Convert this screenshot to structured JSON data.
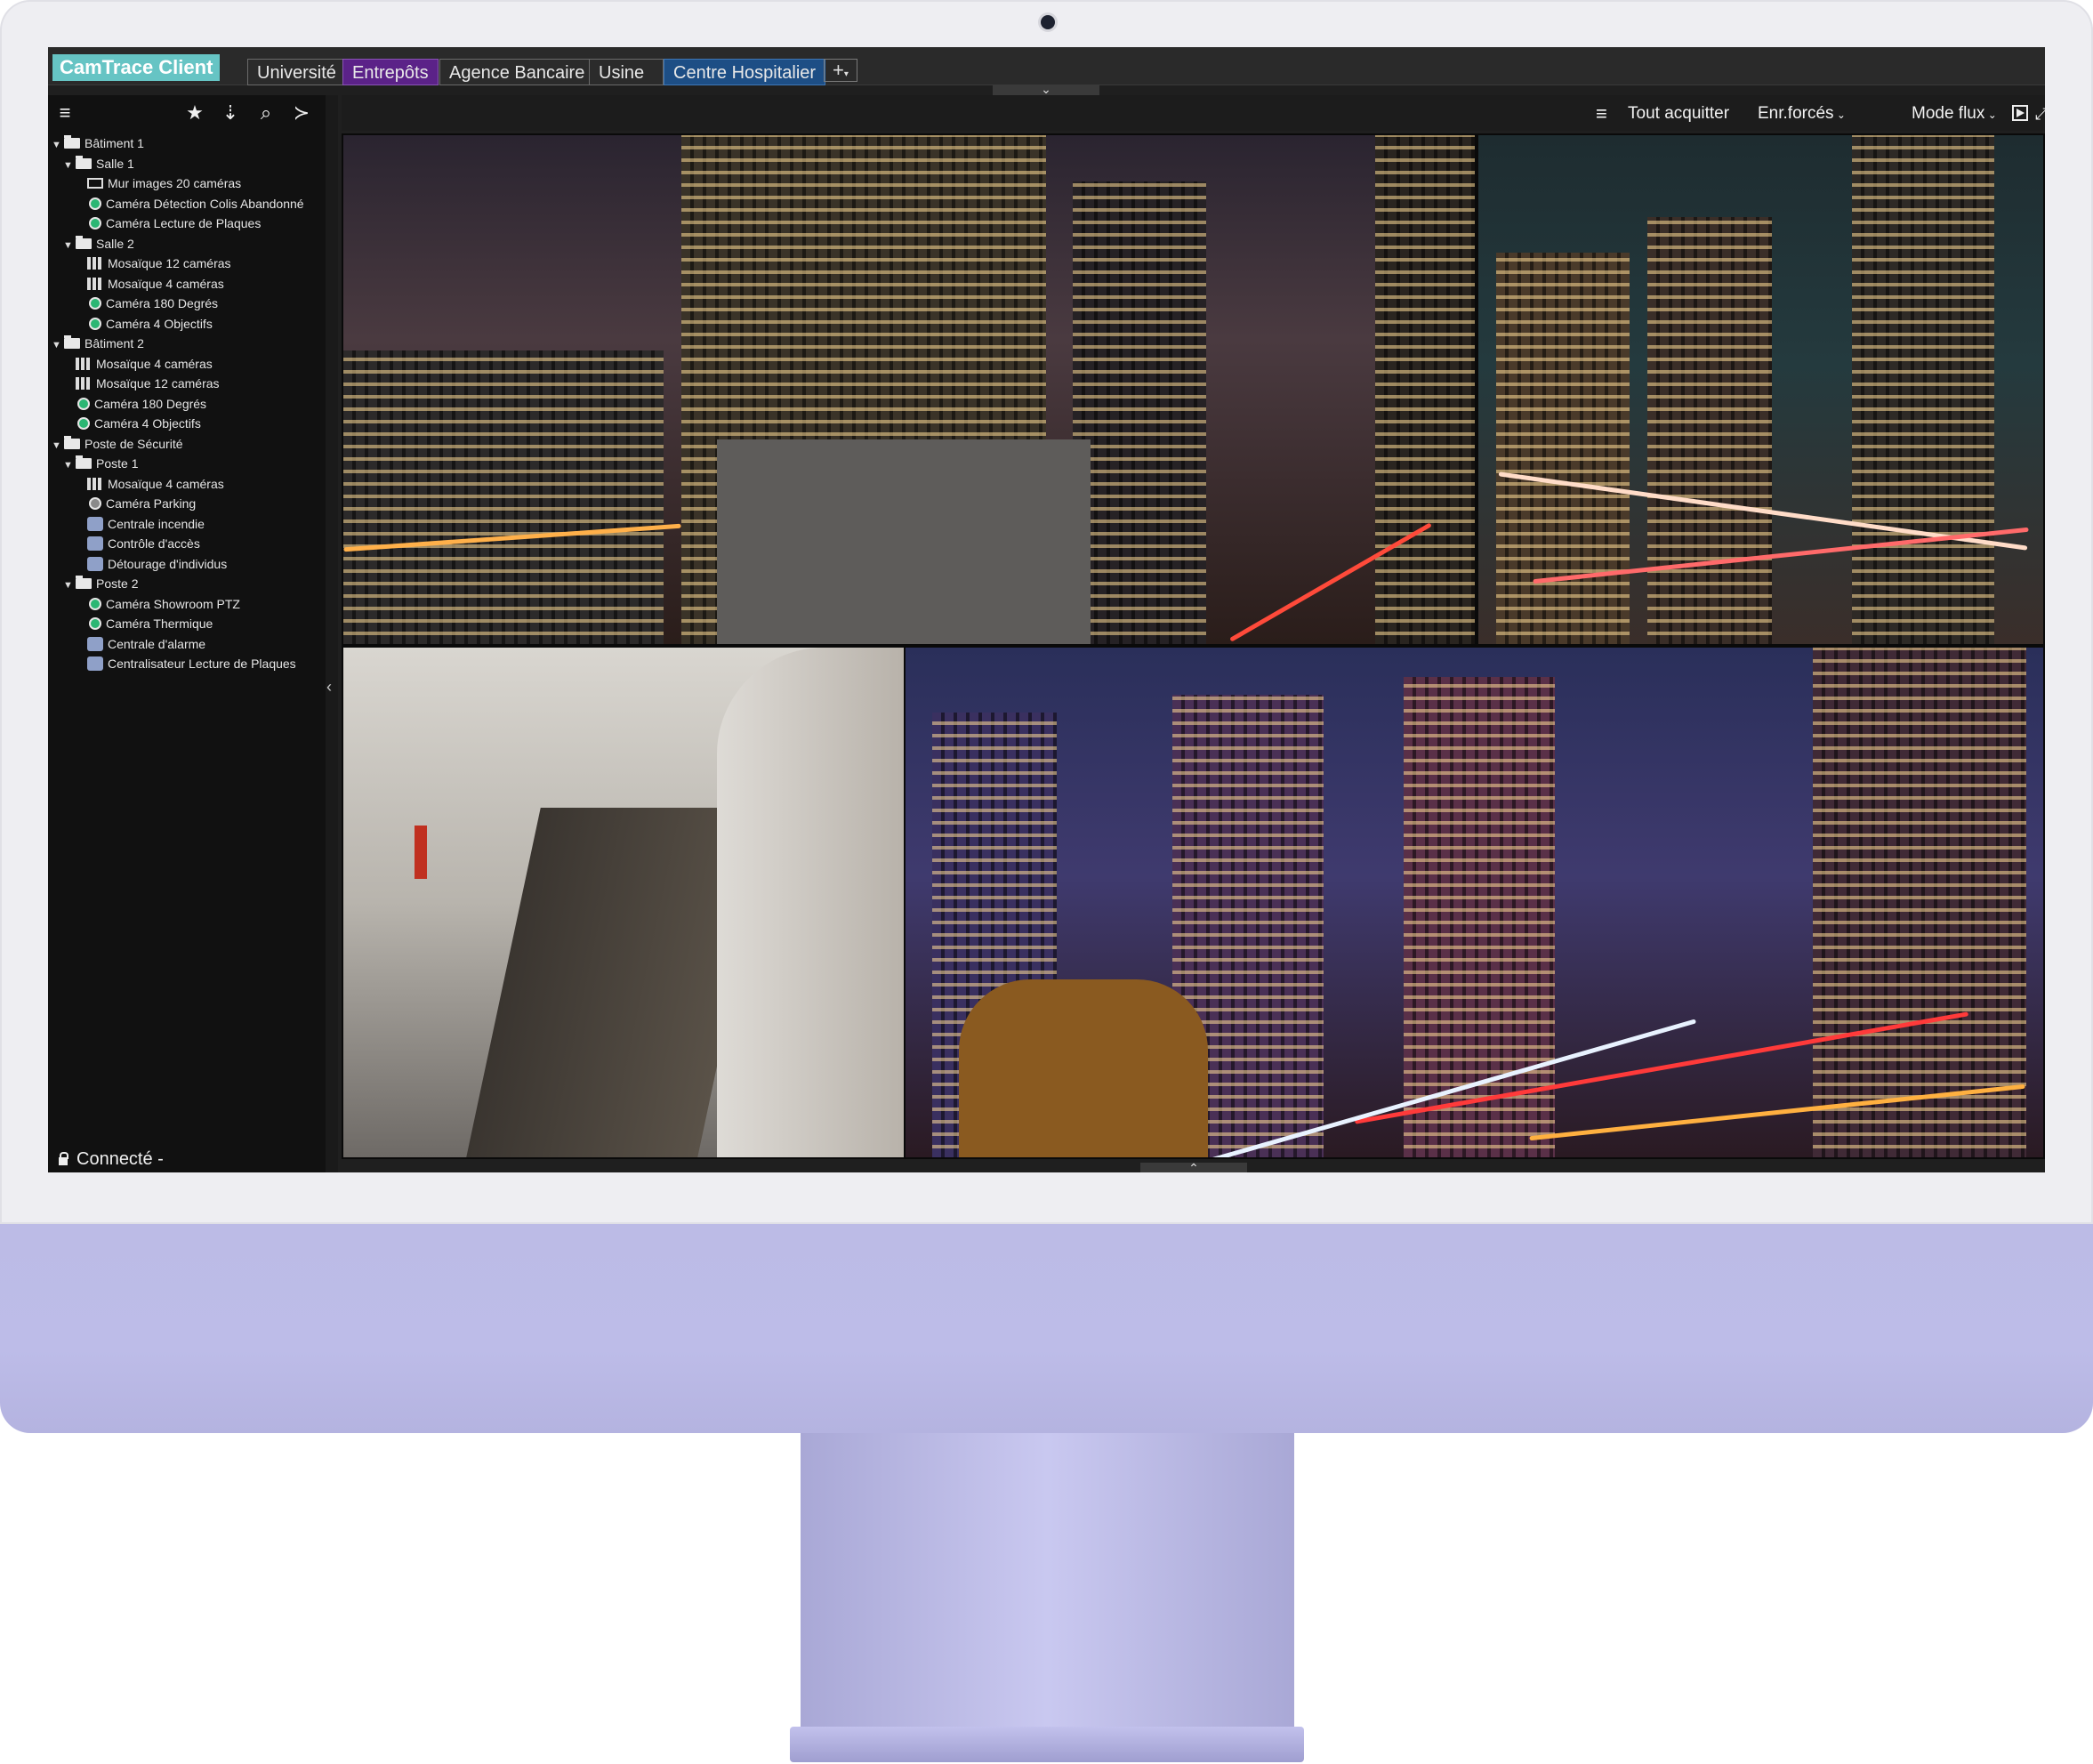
{
  "app": {
    "title": "CamTrace Client"
  },
  "tabs": [
    {
      "label": "Université",
      "style": "default"
    },
    {
      "label": "Entrepôts",
      "style": "purple"
    },
    {
      "label": "Agence Bancaire",
      "style": "default"
    },
    {
      "label": "Usine",
      "style": "default"
    },
    {
      "label": "Centre Hospitalier",
      "style": "blue"
    }
  ],
  "tab_add": {
    "label": "+"
  },
  "sidebar": {
    "tools": [
      "menu-icon",
      "star-icon",
      "sort-icon",
      "search-icon",
      "terminal-icon"
    ],
    "tree": [
      {
        "label": "Bâtiment 1",
        "level": 0,
        "icon": "folder",
        "expanded": true
      },
      {
        "label": "Salle 1",
        "level": 1,
        "icon": "folder",
        "expanded": true
      },
      {
        "label": "Mur images 20 caméras",
        "level": 2,
        "icon": "monitor"
      },
      {
        "label": "Caméra Détection Colis Abandonné",
        "level": 2,
        "icon": "cam"
      },
      {
        "label": "Caméra Lecture de Plaques",
        "level": 2,
        "icon": "cam"
      },
      {
        "label": "Salle 2",
        "level": 1,
        "icon": "folder",
        "expanded": true
      },
      {
        "label": "Mosaïque 12 caméras",
        "level": 2,
        "icon": "grid"
      },
      {
        "label": "Mosaïque 4 caméras",
        "level": 2,
        "icon": "grid"
      },
      {
        "label": "Caméra 180 Degrés",
        "level": 2,
        "icon": "cam"
      },
      {
        "label": "Caméra 4 Objectifs",
        "level": 2,
        "icon": "cam"
      },
      {
        "label": "Bâtiment 2",
        "level": 0,
        "icon": "folder",
        "expanded": true
      },
      {
        "label": "Mosaïque 4 caméras",
        "level": 1,
        "icon": "grid"
      },
      {
        "label": "Mosaïque 12 caméras",
        "level": 1,
        "icon": "grid"
      },
      {
        "label": "Caméra 180 Degrés",
        "level": 1,
        "icon": "cam"
      },
      {
        "label": "Caméra 4 Objectifs",
        "level": 1,
        "icon": "cam"
      },
      {
        "label": "Poste de Sécurité",
        "level": 0,
        "icon": "folder",
        "expanded": true
      },
      {
        "label": "Poste 1",
        "level": 1,
        "icon": "folder",
        "expanded": true
      },
      {
        "label": "Mosaïque 4 caméras",
        "level": 2,
        "icon": "grid"
      },
      {
        "label": "Caméra Parking",
        "level": 2,
        "icon": "camgray"
      },
      {
        "label": "Centrale incendie",
        "level": 2,
        "icon": "alarm"
      },
      {
        "label": "Contrôle d'accès",
        "level": 2,
        "icon": "alarm"
      },
      {
        "label": "Détourage d'individus",
        "level": 2,
        "icon": "alarm"
      },
      {
        "label": "Poste 2",
        "level": 1,
        "icon": "folder",
        "expanded": true
      },
      {
        "label": "Caméra Showroom PTZ",
        "level": 2,
        "icon": "cam"
      },
      {
        "label": "Caméra Thermique",
        "level": 2,
        "icon": "cam"
      },
      {
        "label": "Centrale d'alarme",
        "level": 2,
        "icon": "alarm"
      },
      {
        "label": "Centralisateur Lecture de Plaques",
        "level": 2,
        "icon": "alarm"
      }
    ],
    "footer": {
      "status": "Connecté -"
    }
  },
  "toolbar": {
    "menu": "menu-icon",
    "ack_all": "Tout acquitter",
    "forced_rec": "Enr.forcés",
    "stream_mode": "Mode flux",
    "play": "play-icon",
    "fullscreen": "fullscreen-icon",
    "close": "close-icon"
  },
  "video_tiles": [
    {
      "name": "video-tile-construction-night"
    },
    {
      "name": "video-tile-city-traffic-trails"
    },
    {
      "name": "video-tile-metro-station"
    },
    {
      "name": "video-tile-boulevard-night"
    }
  ],
  "colors": {
    "accent": "#66c4c4",
    "tab_purple": "#5b2288",
    "tab_blue": "#1d4e85",
    "camera_ok": "#2bb673"
  }
}
